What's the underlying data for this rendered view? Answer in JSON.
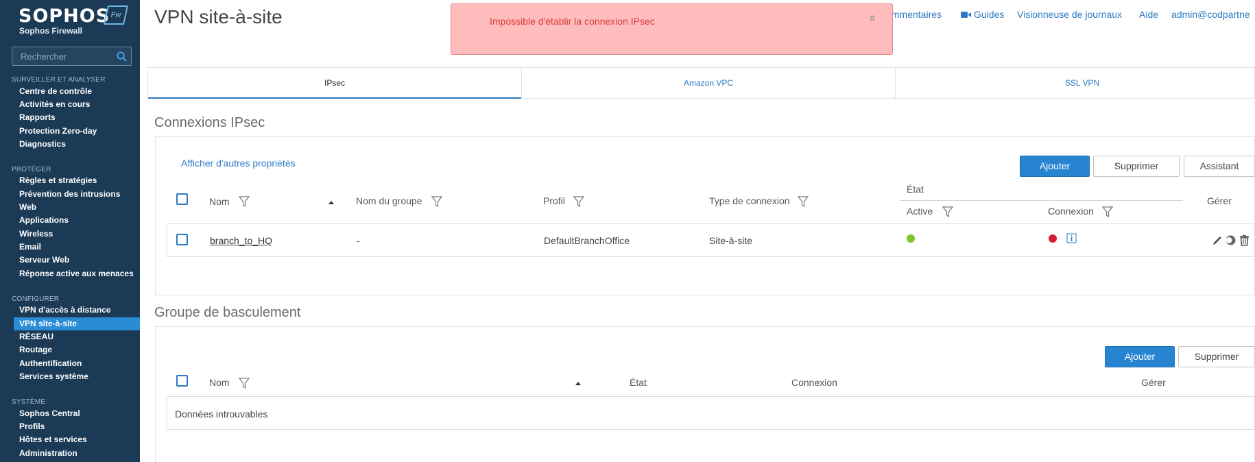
{
  "brand": {
    "name": "SOPHOS",
    "badge": "Fw",
    "product": "Sophos Firewall"
  },
  "search": {
    "placeholder": "Rechercher"
  },
  "nav": {
    "sections": [
      {
        "title": "SURVEILLER ET ANALYSER",
        "items": [
          "Centre de contrôle",
          "Activités en cours",
          "Rapports",
          "Protection Zero-day",
          "Diagnostics"
        ]
      },
      {
        "title": "PROTÉGER",
        "items": [
          "Règles et stratégies",
          "Prévention des intrusions",
          "Web",
          "Applications",
          "Wireless",
          "Email",
          "Serveur Web",
          "Réponse active aux menaces"
        ]
      },
      {
        "title": "CONFIGURER",
        "items": [
          "VPN d'accès à distance",
          "VPN site-à-site",
          "RÉSEAU",
          "Routage",
          "Authentification",
          "Services système"
        ]
      },
      {
        "title": "SYSTÈME",
        "items": [
          "Sophos Central",
          "Profils",
          "Hôtes et services",
          "Administration"
        ]
      }
    ],
    "active_item": "VPN site-à-site"
  },
  "header": {
    "title": "VPN site-à-site",
    "error_message": "Impossible d'établir la connexion IPsec",
    "links": [
      "Commentaires",
      "Guides",
      "Visionneuse de journaux",
      "Aide",
      "admin@codpartne"
    ]
  },
  "tabs": [
    {
      "label": "IPsec",
      "active": true
    },
    {
      "label": "Amazon VPC",
      "active": false
    },
    {
      "label": "SSL VPN",
      "active": false
    }
  ],
  "ipsec": {
    "section_title": "Connexions IPsec",
    "more_props_link": "Afficher d'autres propriétés",
    "buttons": {
      "add": "Ajouter",
      "delete": "Supprimer",
      "wizard": "Assistant"
    },
    "columns": {
      "name": "Nom",
      "group": "Nom du groupe",
      "profile": "Profil",
      "connection_type": "Type de connexion",
      "state": "État",
      "active": "Active",
      "connection": "Connexion",
      "manage": "Gérer"
    },
    "rows": [
      {
        "name": "branch_to_HQ",
        "group": "-",
        "profile": "DefaultBranchOffice",
        "connection_type": "Site-à-site",
        "active_color": "#7cc52a",
        "connection_color": "#d21f2f"
      }
    ]
  },
  "failover": {
    "section_title": "Groupe de basculement",
    "buttons": {
      "add": "Ajouter",
      "delete": "Supprimer"
    },
    "columns": {
      "name": "Nom",
      "state": "État",
      "connection": "Connexion",
      "manage": "Gérer"
    },
    "empty_text": "Données introuvables"
  },
  "colors": {
    "sidebar": "#1b3a55",
    "accent": "#2784d1",
    "error_bg": "#ffbcbc",
    "error_text": "#d83a3a"
  }
}
